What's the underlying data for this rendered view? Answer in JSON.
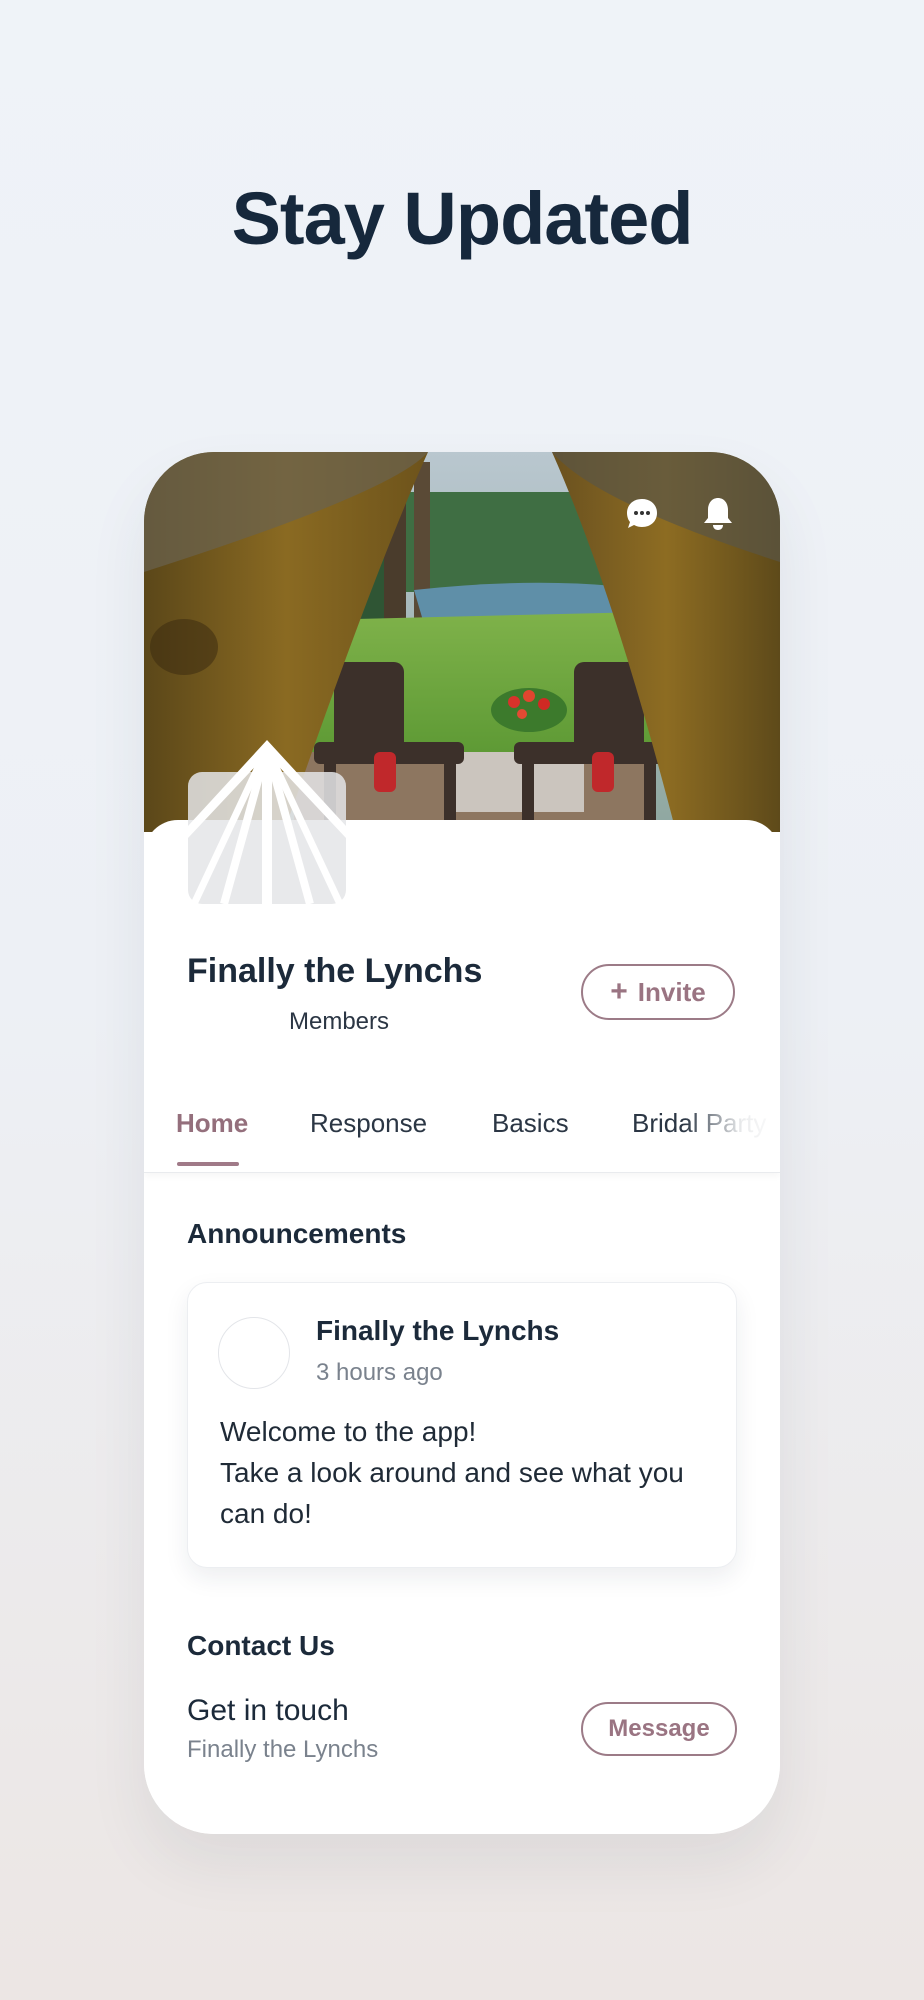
{
  "headline": "Stay Updated",
  "cover": {
    "image": "tent-lake-view-photo"
  },
  "top_actions": {
    "chat_icon": "chat-bubble-icon",
    "bell_icon": "bell-icon"
  },
  "group": {
    "logo": "tent-logo",
    "name": "Finally the Lynchs",
    "subtitle": "Members",
    "invite_label": "Invite",
    "invite_icon": "plus-icon"
  },
  "tabs": [
    {
      "label": "Home",
      "active": true
    },
    {
      "label": "Response",
      "active": false
    },
    {
      "label": "Basics",
      "active": false
    },
    {
      "label": "Bridal Party",
      "active": false
    }
  ],
  "announcements": {
    "title": "Announcements",
    "post": {
      "author": "Finally the Lynchs",
      "time": "3 hours ago",
      "body_lines": [
        "Welcome to the app!",
        "Take a look around and see what you",
        "can do!"
      ]
    }
  },
  "contact": {
    "title": "Contact Us",
    "heading": "Get in touch",
    "subtitle": "Finally the Lynchs",
    "message_label": "Message"
  },
  "colors": {
    "accent": "#9a7482",
    "text_dark": "#1c2a3a",
    "text_muted": "#7a828d"
  }
}
